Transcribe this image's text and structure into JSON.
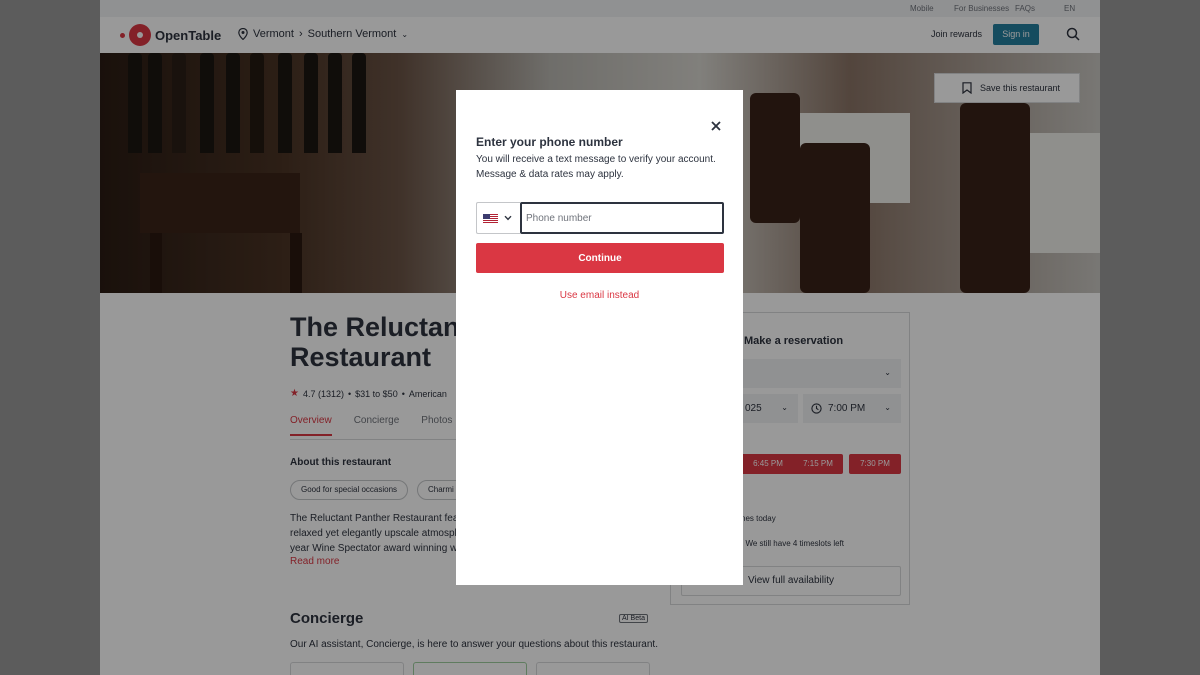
{
  "topbar": {
    "mobile": "Mobile",
    "for_businesses": "For Businesses",
    "faqs": "FAQs",
    "language": "EN"
  },
  "header": {
    "brand": "OpenTable",
    "location_region": "Vermont",
    "location_sub": "Southern Vermont",
    "join_rewards": "Join rewards",
    "sign_in": "Sign in"
  },
  "hero": {
    "save_label": "Save this restaurant"
  },
  "restaurant": {
    "title": "The Reluctant P… Restaurant",
    "title_line1": "The Reluctant P",
    "title_line2": "Restaurant",
    "rating": "4.7 (1312)",
    "price": "$31 to $50",
    "cuisine": "American",
    "tabs": [
      "Overview",
      "Concierge",
      "Photos"
    ],
    "about_heading": "About this restaurant",
    "tags": [
      "Good for special occasions",
      "Charmi"
    ],
    "description_lines": [
      "The Reluctant Panther Restaurant feat",
      "relaxed yet elegantly upscale atmosphe",
      "year Wine Spectator award winning wi"
    ],
    "read_more": "Read more",
    "concierge_heading": "Concierge",
    "ai_badge": "AI Beta",
    "concierge_text": "Our AI assistant, Concierge, is here to answer your questions about this restaurant."
  },
  "reservation": {
    "heading": "Make a reservation",
    "date_value": "025",
    "time_value": "7:00 PM",
    "slots": [
      "6:45 PM",
      "7:15 PM",
      "7:30 PM"
    ],
    "note1": "nes today",
    "note2": "! We still have 4 timeslots left",
    "view_full": "View full availability"
  },
  "modal": {
    "title": "Enter your phone number",
    "description": "You will receive a text message to verify your account. Message & data rates may apply.",
    "phone_placeholder": "Phone number",
    "continue_label": "Continue",
    "use_email_label": "Use email instead"
  },
  "colors": {
    "brand_red": "#da3743",
    "sign_in_blue": "#247f9e",
    "text_dark": "#2d333f"
  }
}
